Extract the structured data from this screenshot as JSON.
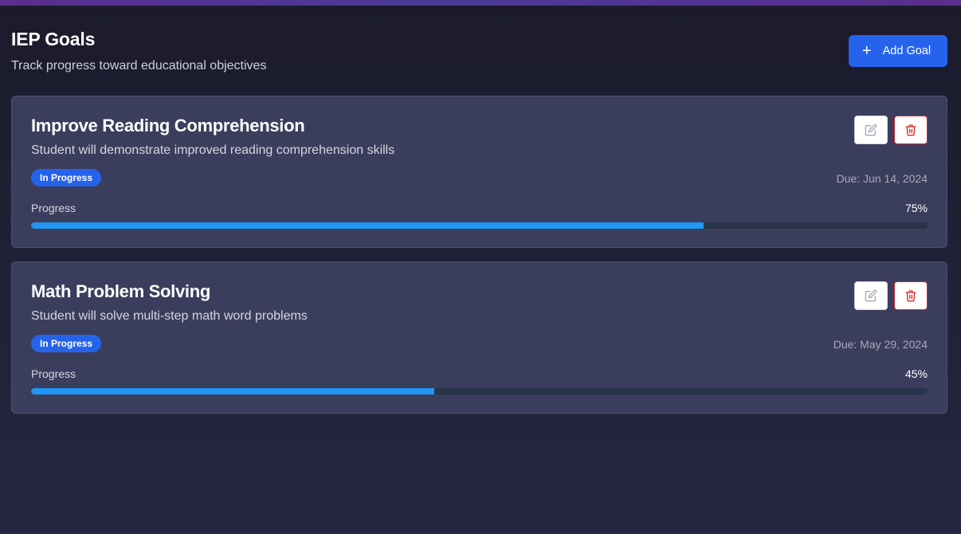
{
  "header": {
    "title": "IEP Goals",
    "subtitle": "Track progress toward educational objectives",
    "add_button_label": "Add Goal",
    "add_button_icon": "plus-icon"
  },
  "colors": {
    "primary": "#2563eb",
    "progress_fill": "#2196f3",
    "delete_accent": "#dc2626"
  },
  "goals": [
    {
      "title": "Improve Reading Comprehension",
      "description": "Student will demonstrate improved reading comprehension skills",
      "status": "In Progress",
      "due": "Due: Jun 14, 2024",
      "progress_label": "Progress",
      "progress_text": "75%",
      "progress_fraction": 0.75,
      "edit_icon": "edit-icon",
      "delete_icon": "trash-icon"
    },
    {
      "title": "Math Problem Solving",
      "description": "Student will solve multi-step math word problems",
      "status": "In Progress",
      "due": "Due: May 29, 2024",
      "progress_label": "Progress",
      "progress_text": "45%",
      "progress_fraction": 0.45,
      "edit_icon": "edit-icon",
      "delete_icon": "trash-icon"
    }
  ]
}
